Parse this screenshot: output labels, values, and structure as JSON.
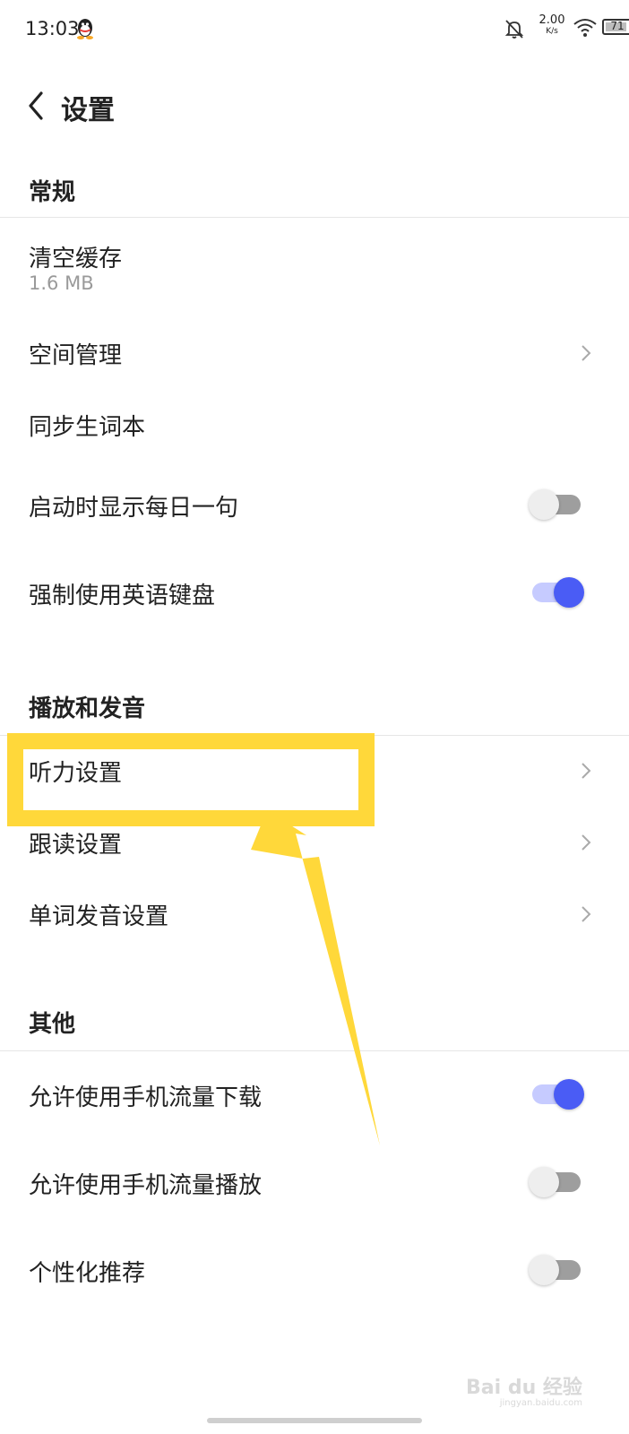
{
  "status_bar": {
    "time": "13:03",
    "net_speed_value": "2.00",
    "net_speed_unit": "K/s",
    "battery": "71",
    "icons": [
      "qq-icon",
      "bell-off-icon",
      "wifi-icon",
      "battery-icon"
    ]
  },
  "header": {
    "title": "设置"
  },
  "sections": {
    "general": {
      "title": "常规"
    },
    "playback": {
      "title": "播放和发音"
    },
    "other": {
      "title": "其他"
    }
  },
  "items": {
    "clear_cache": {
      "label": "清空缓存",
      "value": "1.6 MB"
    },
    "space_manage": {
      "label": "空间管理"
    },
    "sync_vocab": {
      "label": "同步生词本"
    },
    "daily_sentence": {
      "label": "启动时显示每日一句",
      "on": false
    },
    "force_english_kb": {
      "label": "强制使用英语键盘",
      "on": true
    },
    "listening": {
      "label": "听力设置"
    },
    "follow_read": {
      "label": "跟读设置"
    },
    "word_pronunciation": {
      "label": "单词发音设置"
    },
    "mobile_download": {
      "label": "允许使用手机流量下载",
      "on": true
    },
    "mobile_play": {
      "label": "允许使用手机流量播放",
      "on": false
    },
    "personalized": {
      "label": "个性化推荐",
      "on": false
    }
  },
  "watermark": {
    "text": "Bai du 经验",
    "sub": "jingyan.baidu.com"
  },
  "colors": {
    "accent": "#4a5cf5",
    "accent_track": "#c6cbff",
    "highlight": "#ffd83a"
  }
}
